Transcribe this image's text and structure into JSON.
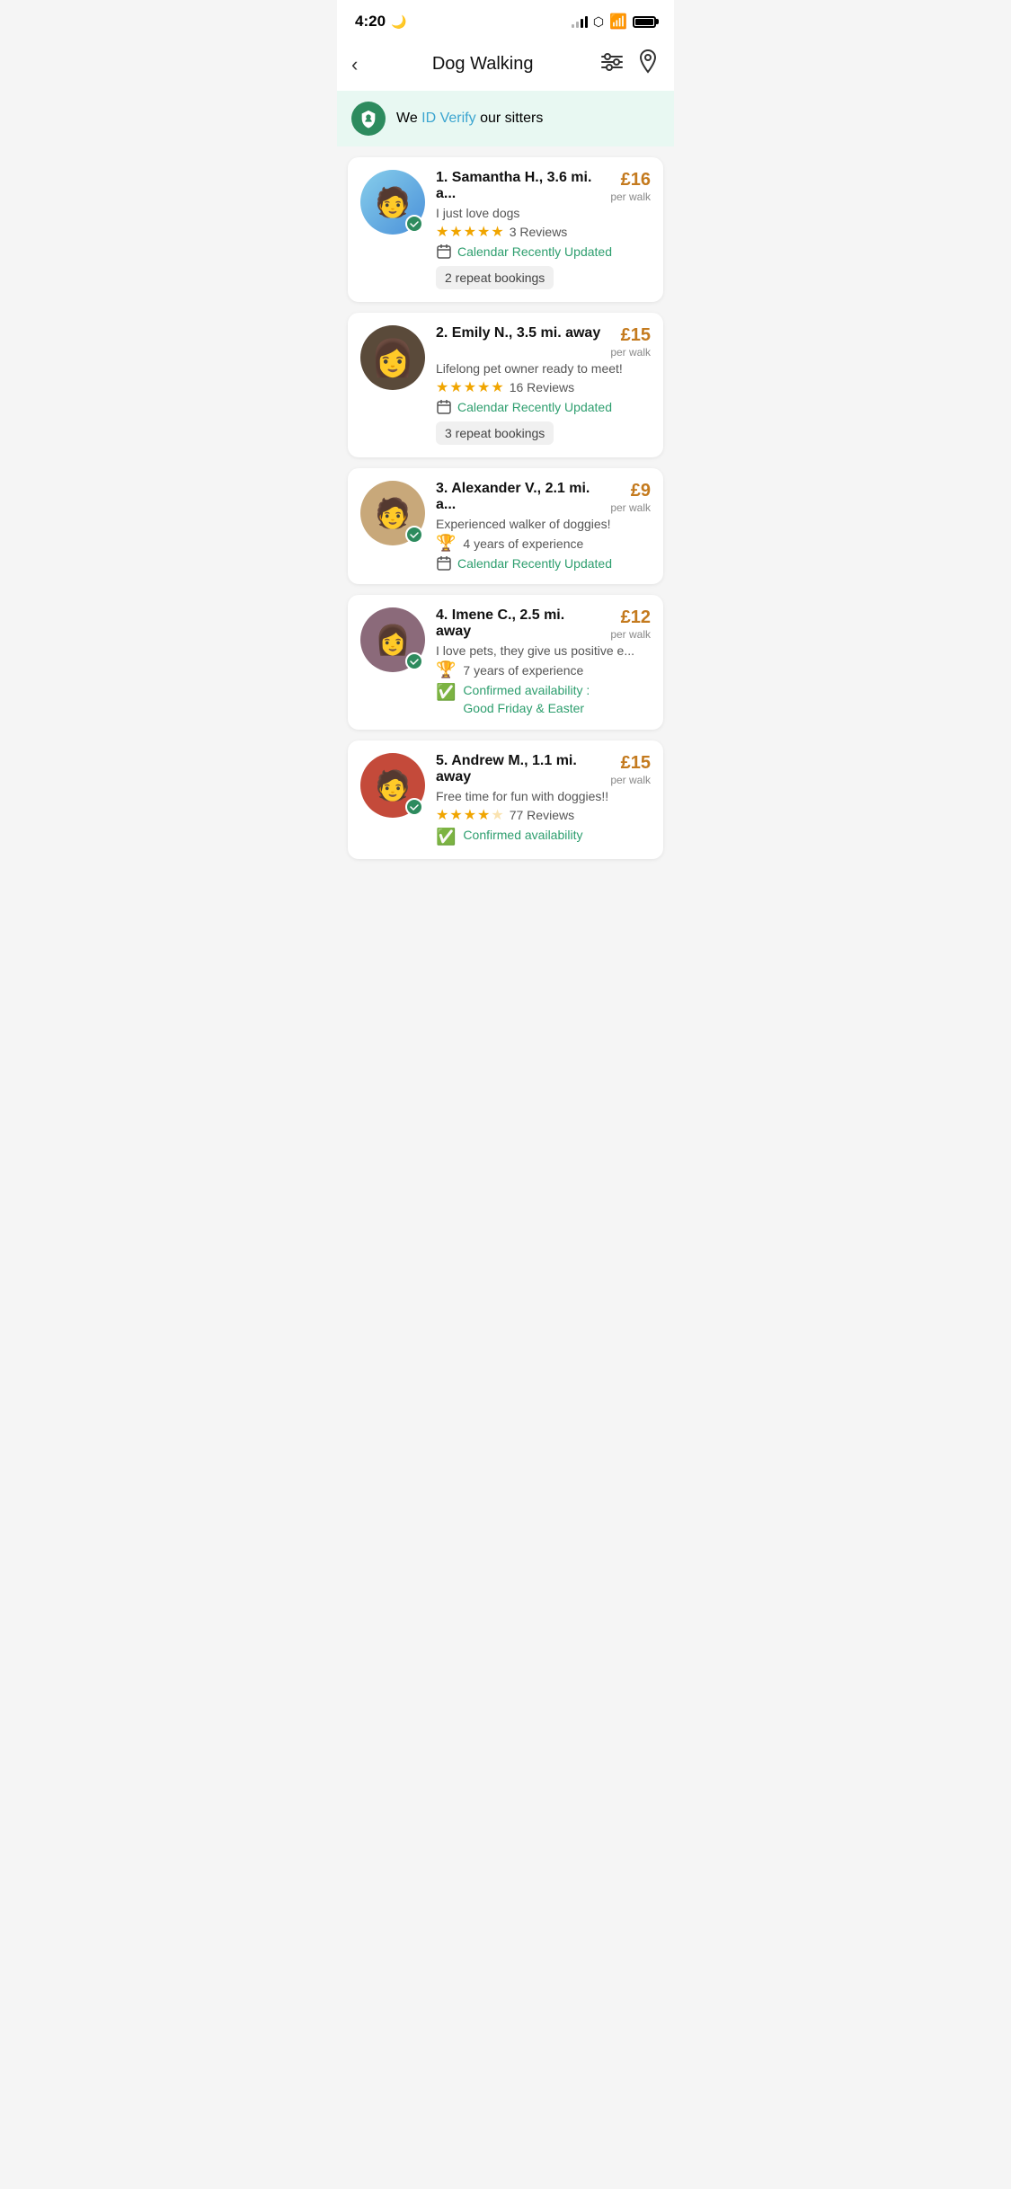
{
  "statusBar": {
    "time": "4:20",
    "moonIcon": "🌙"
  },
  "header": {
    "backLabel": "‹",
    "title": "Dog Walking",
    "filterIconLabel": "filter-icon",
    "locationIconLabel": "location-icon"
  },
  "idVerifyBanner": {
    "text_before": "We ",
    "link": "ID Verify",
    "text_after": " our sitters"
  },
  "sitters": [
    {
      "rank": "1.",
      "name": "Samantha H.,",
      "distance": "3.6 mi. a...",
      "tagline": "I just love dogs",
      "price": "£16",
      "perWalk": "per walk",
      "stars": 5,
      "reviews": "3 Reviews",
      "calendarText": "Calendar Recently Updated",
      "badge": "2 repeat bookings",
      "hasVerified": true,
      "experience": null,
      "availability": null,
      "avatarClass": "avatar-1"
    },
    {
      "rank": "2.",
      "name": "Emily N.,",
      "distance": "3.5 mi. away",
      "tagline": "Lifelong pet owner ready to meet!",
      "price": "£15",
      "perWalk": "per walk",
      "stars": 5,
      "reviews": "16 Reviews",
      "calendarText": "Calendar Recently Updated",
      "badge": "3 repeat bookings",
      "hasVerified": false,
      "experience": null,
      "availability": null,
      "avatarClass": "avatar-2"
    },
    {
      "rank": "3.",
      "name": "Alexander V.,",
      "distance": "2.1 mi. a...",
      "tagline": "Experienced walker of doggies!",
      "price": "£9",
      "perWalk": "per walk",
      "stars": 0,
      "reviews": null,
      "calendarText": "Calendar Recently Updated",
      "badge": null,
      "hasVerified": true,
      "experience": "4 years of experience",
      "availability": null,
      "avatarClass": "avatar-3"
    },
    {
      "rank": "4.",
      "name": "Imene C.,",
      "distance": "2.5 mi. away",
      "tagline": "I love pets, they give us positive e...",
      "price": "£12",
      "perWalk": "per walk",
      "stars": 0,
      "reviews": null,
      "calendarText": null,
      "badge": null,
      "hasVerified": true,
      "experience": "7 years of experience",
      "availability": "Confirmed availability :\nGood Friday & Easter",
      "avatarClass": "avatar-4"
    },
    {
      "rank": "5.",
      "name": "Andrew M.,",
      "distance": "1.1 mi. away",
      "tagline": "Free time for fun with doggies!!",
      "price": "£15",
      "perWalk": "per walk",
      "stars": 4,
      "reviews": "77 Reviews",
      "calendarText": null,
      "badge": null,
      "hasVerified": true,
      "experience": null,
      "availability": "Confirmed availability",
      "avatarClass": "avatar-5"
    }
  ]
}
